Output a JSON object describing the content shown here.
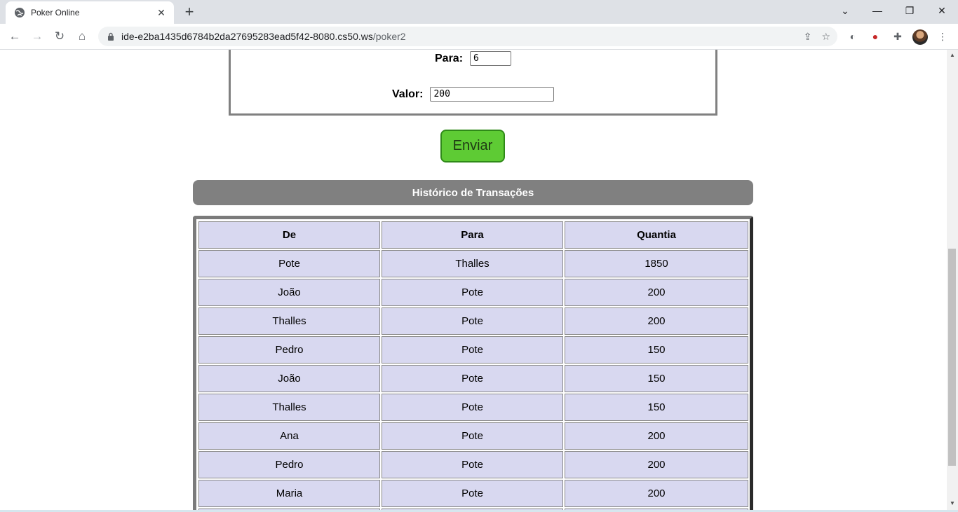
{
  "browser": {
    "tab_title": "Poker Online",
    "url_host": "ide-e2ba1435d6784b2da27695283ead5f42-8080.cs50.ws",
    "url_path": "/poker2"
  },
  "form": {
    "para_label": "Para:",
    "para_value": "6",
    "valor_label": "Valor:",
    "valor_value": "200",
    "submit_label": "Enviar"
  },
  "history": {
    "title": "Histórico de Transações",
    "columns": [
      "De",
      "Para",
      "Quantia"
    ],
    "rows": [
      [
        "Pote",
        "Thalles",
        "1850"
      ],
      [
        "João",
        "Pote",
        "200"
      ],
      [
        "Thalles",
        "Pote",
        "200"
      ],
      [
        "Pedro",
        "Pote",
        "150"
      ],
      [
        "João",
        "Pote",
        "150"
      ],
      [
        "Thalles",
        "Pote",
        "150"
      ],
      [
        "Ana",
        "Pote",
        "200"
      ],
      [
        "Pedro",
        "Pote",
        "200"
      ],
      [
        "Maria",
        "Pote",
        "200"
      ],
      [
        "",
        "",
        ""
      ]
    ]
  },
  "colors": {
    "submit_bg": "#5ecb34",
    "history_bar_bg": "#808080",
    "cell_bg": "#d8d8f0"
  }
}
